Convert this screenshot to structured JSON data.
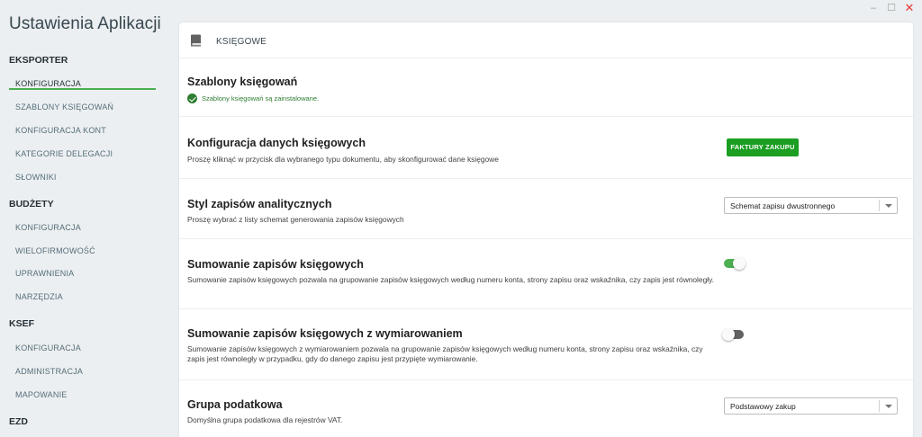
{
  "window": {
    "minimize": "–",
    "maximize": "☐",
    "close": "✕"
  },
  "sidebar": {
    "title": "Ustawienia Aplikacji",
    "sections": [
      {
        "label": "EKSPORTER",
        "items": [
          "KONFIGURACJA",
          "SZABLONY KSIĘGOWAŃ",
          "KONFIGURACJA KONT",
          "KATEGORIE DELEGACJI",
          "SŁOWNIKI"
        ]
      },
      {
        "label": "BUDŻETY",
        "items": [
          "KONFIGURACJA",
          "WIELOFIRMOWOŚĆ",
          "UPRAWNIENIA",
          "NARZĘDZIA"
        ]
      },
      {
        "label": "KSEF",
        "items": [
          "KONFIGURACJA",
          "ADMINISTRACJA",
          "MAPOWANIE"
        ]
      },
      {
        "label": "EZD",
        "items": []
      }
    ],
    "active_item": "EKSPORTER/KONFIGURACJA"
  },
  "card": {
    "icon": "book-icon",
    "title": "KSIĘGOWE",
    "rows": [
      {
        "title": "Szablony księgowań",
        "status": "Szablony księgowań są zainstalowane."
      },
      {
        "title": "Konfiguracja danych księgowych",
        "desc": "Proszę kliknąć w przycisk dla wybranego typu dokumentu, aby skonfigurować dane księgowe",
        "button": "FAKTURY ZAKUPU"
      },
      {
        "title": "Styl zapisów analitycznych",
        "desc": "Proszę wybrać z listy schemat generowania zapisów księgowych",
        "select": "Schemat zapisu dwustronnego"
      },
      {
        "title": "Sumowanie zapisów księgowych",
        "desc": "Sumowanie zapisów księgowych pozwala na grupowanie zapisów księgowych według numeru konta, strony zapisu oraz wskaźnika, czy zapis jest równoległy.",
        "toggle": true
      },
      {
        "title": "Sumowanie zapisów księgowych z wymiarowaniem",
        "desc": "Sumowanie zapisów księgowych z wymiarowaniem pozwala na grupowanie zapisów księgowych według numeru konta, strony zapisu oraz wskaźnika, czy zapis jest równoległy w przypadku, gdy do danego zapisu jest przypięte wymiarowanie.",
        "toggle": false
      },
      {
        "title": "Grupa podatkowa",
        "desc": "Domyślna grupa podatkowa dla rejestrów VAT.",
        "select": "Podstawowy zakup"
      }
    ]
  },
  "colors": {
    "accent": "#4caf50",
    "button": "#1b9e22",
    "success": "#2e7d32"
  }
}
